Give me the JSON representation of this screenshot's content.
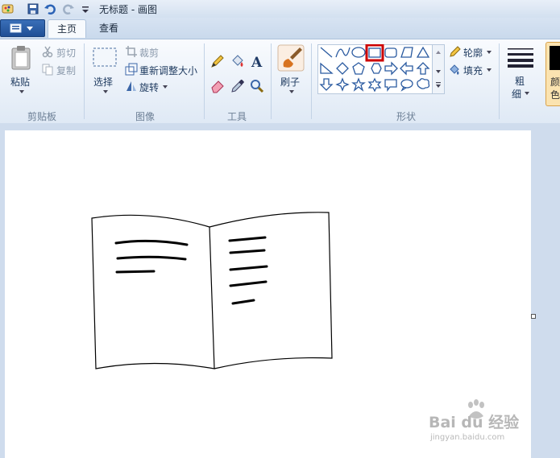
{
  "window": {
    "title": "无标题 - 画图"
  },
  "tabs": [
    {
      "label": "主页"
    },
    {
      "label": "查看"
    }
  ],
  "ribbon": {
    "clipboard": {
      "label": "剪贴板",
      "paste": "粘贴",
      "cut": "剪切",
      "copy": "复制"
    },
    "image": {
      "label": "图像",
      "select": "选择",
      "crop": "裁剪",
      "resize": "重新调整大小",
      "rotate": "旋转"
    },
    "tools": {
      "label": "工具"
    },
    "brush": {
      "label": "刷子"
    },
    "shapes": {
      "label": "形状",
      "outline": "轮廓",
      "fill": "填充"
    },
    "size": {
      "line1": "粗",
      "line2": "细"
    },
    "color": {
      "line1": "颜",
      "line2": "色"
    }
  },
  "watermark": {
    "text": "Bai du 经验",
    "url": "jingyan.baidu.com"
  },
  "colors": {
    "highlight": "#cc0000",
    "accent": "#1f4f95"
  }
}
